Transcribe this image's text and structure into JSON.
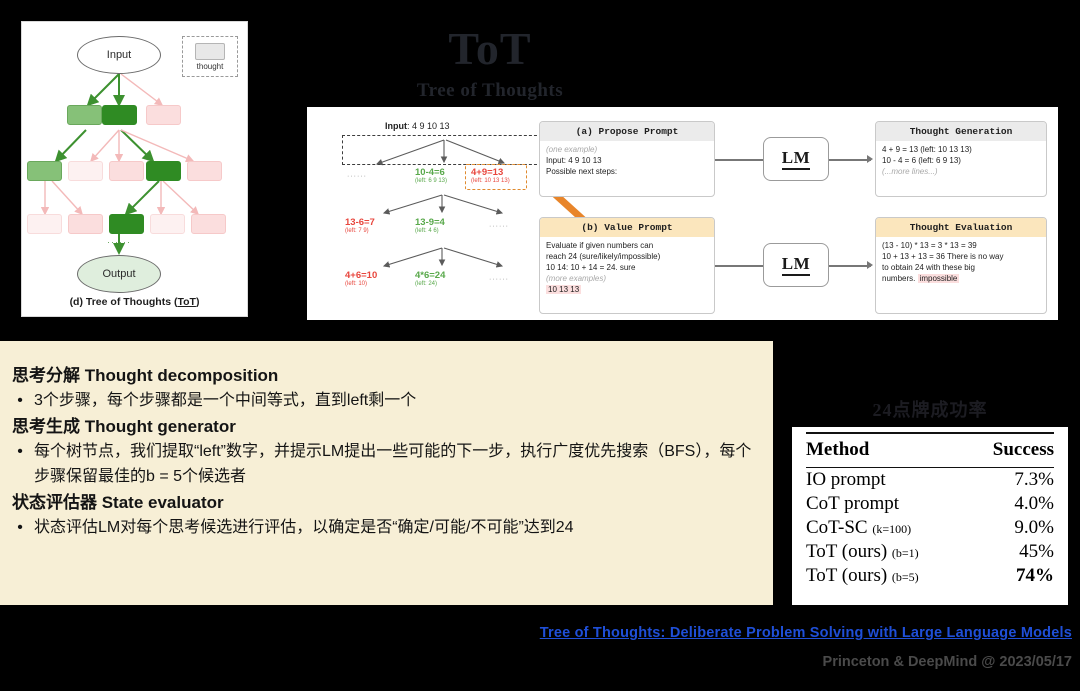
{
  "slide": {
    "title": "ToT",
    "subtitle": "Tree of Thoughts",
    "bg_color": "#000000",
    "panel_color": "#f7efd6",
    "link_color": "#1f4fd8"
  },
  "figure_left": {
    "caption_prefix": "(d) Tree of Thoughts (",
    "caption_abbr": "ToT",
    "caption_suffix": ")",
    "legend_label": "thought",
    "input_label": "Input",
    "output_label": "Output",
    "ellipsis": "······"
  },
  "figure_right": {
    "input_prefix": "Input",
    "input_numbers": "4 9 10 13",
    "tree": {
      "level1": [
        {
          "eq": "10-4=6",
          "left": "(left: 6 9 13)",
          "color": "green"
        },
        {
          "eq": "4+9=13",
          "left": "(left: 10 13 13)",
          "color": "red"
        }
      ],
      "level2": [
        {
          "eq": "13-6=7",
          "left": "(left: 7 9)",
          "color": "red"
        },
        {
          "eq": "13-9=4",
          "left": "(left: 4 6)",
          "color": "green"
        }
      ],
      "level3": [
        {
          "eq": "4+6=10",
          "left": "(left: 10)",
          "color": "red"
        },
        {
          "eq": "4*6=24",
          "left": "(left: 24)",
          "color": "green"
        }
      ],
      "ellipsis": "······"
    },
    "propose_prompt": {
      "header": "(a) Propose Prompt",
      "line_example": "(one example)",
      "line_input": "Input: 4 9 10 13",
      "line_steps": "Possible next steps:"
    },
    "value_prompt": {
      "header": "(b) Value Prompt",
      "line1": "Evaluate if given numbers can",
      "line2": "reach 24 (sure/likely/impossible)",
      "line3": "10 14: 10 + 14 = 24. sure",
      "line4": "(more examples)",
      "line5": "10 13 13"
    },
    "lm_label": "LM",
    "thought_generation": {
      "header": "Thought Generation",
      "line1": "4 + 9 = 13 (left: 10 13 13)",
      "line2": "10 - 4 = 6 (left: 6 9 13)",
      "line3": "(...more lines...)"
    },
    "thought_evaluation": {
      "header": "Thought Evaluation",
      "line1": "(13 - 10) * 13 = 3 * 13 = 39",
      "line2": "10 + 13 + 13 = 36 There is no way",
      "line3": "to obtain 24 with these big",
      "line4_prefix": "numbers. ",
      "line4_verdict": "impossible"
    }
  },
  "content": {
    "sections": [
      {
        "heading": "思考分解 Thought decomposition",
        "bullets": [
          "3个步骤，每个步骤都是一个中间等式，直到left剩一个"
        ]
      },
      {
        "heading": "思考生成 Thought generator",
        "bullets": [
          "每个树节点，我们提取“left”数字，并提示LM提出一些可能的下一步，执行广度优先搜索（BFS），每个步骤保留最佳的b = 5个候选者"
        ]
      },
      {
        "heading": "状态评估器 State evaluator",
        "bullets": [
          "状态评估LM对每个思考候选进行评估，以确定是否“确定/可能/不可能”达到24"
        ]
      }
    ],
    "bullet_marker": "•"
  },
  "results": {
    "title": "24点牌成功率",
    "columns": [
      "Method",
      "Success"
    ],
    "rows": [
      {
        "method": "IO prompt",
        "note": "",
        "success": "7.3%",
        "bold": false
      },
      {
        "method": "CoT prompt",
        "note": "",
        "success": "4.0%",
        "bold": false
      },
      {
        "method": "CoT-SC",
        "note": "(k=100)",
        "success": "9.0%",
        "bold": false
      },
      {
        "method": "ToT (ours)",
        "note": "(b=1)",
        "success": "45%",
        "bold": false
      },
      {
        "method": "ToT (ours)",
        "note": "(b=5)",
        "success": "74%",
        "bold": true
      }
    ]
  },
  "footer": {
    "link": "Tree of Thoughts: Deliberate Problem Solving with Large Language Models",
    "credit": "Princeton & DeepMind @ 2023/05/17"
  }
}
